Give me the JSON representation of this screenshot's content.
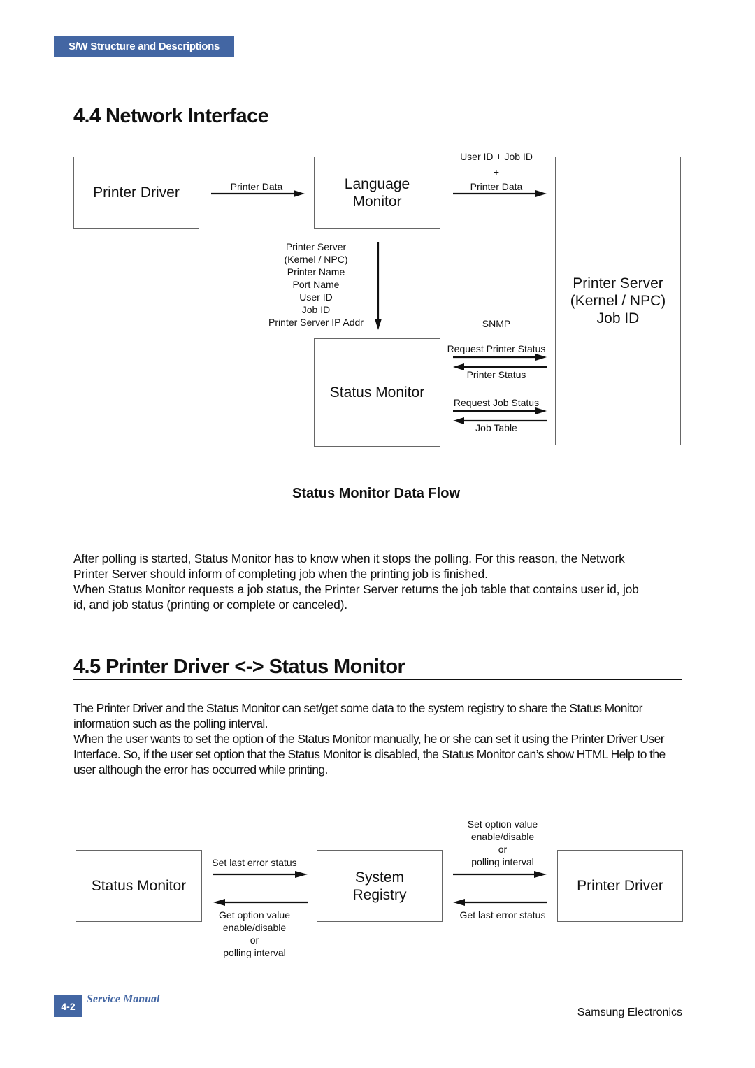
{
  "header": {
    "section_tab": "S/W Structure and Descriptions"
  },
  "section_44": {
    "title": "4.4 Network Interface",
    "diagram": {
      "boxes": {
        "printer_driver": "Printer Driver",
        "language_monitor": "Language\nMonitor",
        "printer_server": "Printer Server\n(Kernel / NPC)\nJob ID",
        "status_monitor": "Status Monitor"
      },
      "labels": {
        "driver_to_lm": "Printer Data",
        "lm_to_server": "User ID + Job ID\n+\nPrinter Data",
        "lm_to_status": "Printer Server\n(Kernel / NPC)\nPrinter Name\nPort Name\nUser ID\nJob ID\nPrinter Server IP Addr",
        "snmp": "SNMP",
        "request_printer_status": "Request Printer Status",
        "printer_status": "Printer Status",
        "request_job_status": "Request Job Status",
        "job_table": "Job Table"
      },
      "caption": "Status Monitor Data Flow"
    },
    "paragraphs": [
      "After polling is started, Status Monitor has to know when it stops the polling. For this reason, the Network Printer Server should inform of completing job when the printing job is finished.",
      "When Status Monitor requests a job status, the Printer Server returns the job table that contains user id, job id, and job status (printing or complete or canceled)."
    ]
  },
  "section_45": {
    "title": "4.5 Printer Driver <-> Status Monitor",
    "paragraphs": [
      "The Printer Driver and the Status Monitor can set/get some data to the system registry to share the Status Monitor information such as the polling interval.",
      "When the user wants to set the option of the Status Monitor manually, he or she can set it using the Printer Driver User Interface. So, if the user set option that the Status Monitor is disabled, the Status Monitor can’s show HTML Help to the user although the error has occurred while printing."
    ],
    "diagram": {
      "boxes": {
        "status_monitor": "Status Monitor",
        "system_registry": "System\nRegistry",
        "printer_driver": "Printer Driver"
      },
      "labels": {
        "set_last_error": "Set last error status",
        "get_option": "Get option value\nenable/disable\nor\npolling interval",
        "set_option": "Set option value\nenable/disable\nor\npolling interval",
        "get_last_error": "Get last error status"
      }
    }
  },
  "footer": {
    "page_number": "4-2",
    "manual_label": "Service Manual",
    "company": "Samsung Electronics"
  }
}
